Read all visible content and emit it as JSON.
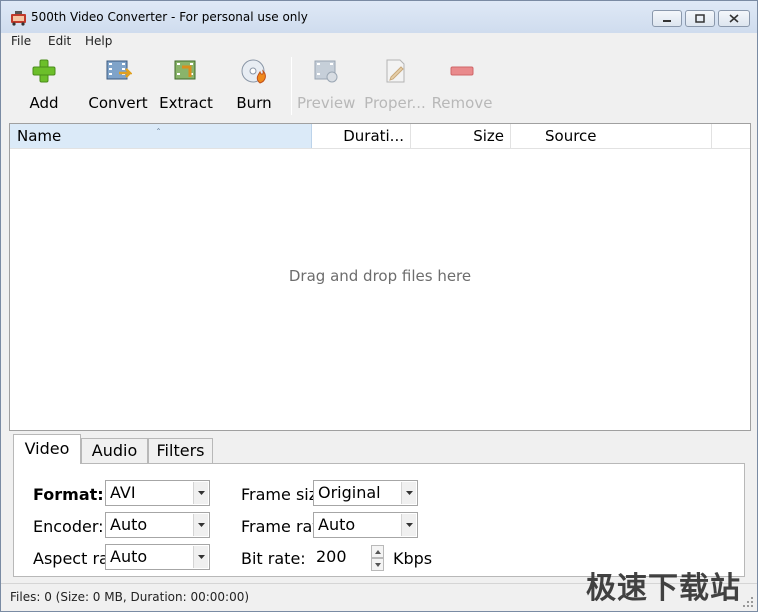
{
  "window": {
    "title": "500th Video Converter - For personal use only"
  },
  "menu": {
    "items": [
      "File",
      "Edit",
      "Help"
    ]
  },
  "toolbar": {
    "buttons": [
      {
        "label": "Add",
        "icon": "plus-icon",
        "enabled": true
      },
      {
        "label": "Convert",
        "icon": "convert-film-icon",
        "enabled": true
      },
      {
        "label": "Extract",
        "icon": "extract-icon",
        "enabled": true
      },
      {
        "label": "Burn",
        "icon": "burn-disc-icon",
        "enabled": true
      },
      {
        "label": "Preview",
        "icon": "preview-film-icon",
        "enabled": false
      },
      {
        "label": "Proper...",
        "icon": "properties-icon",
        "enabled": false
      },
      {
        "label": "Remove",
        "icon": "minus-icon",
        "enabled": false
      }
    ]
  },
  "file_list": {
    "columns": [
      "Name",
      "Durati...",
      "Size",
      "Source"
    ],
    "empty_hint": "Drag and drop files here"
  },
  "settings": {
    "tabs": [
      "Video",
      "Audio",
      "Filters"
    ],
    "active_tab": "Video",
    "video": {
      "format_label": "Format:",
      "format_value": "AVI",
      "encoder_label": "Encoder:",
      "encoder_value": "Auto",
      "aspect_label": "Aspect ra",
      "aspect_value": "Auto",
      "frame_size_label": "Frame siz",
      "frame_size_value": "Original",
      "frame_rate_label": "Frame rat",
      "frame_rate_value": "Auto",
      "bitrate_label": "Bit rate:",
      "bitrate_value": "200",
      "bitrate_unit": "Kbps"
    }
  },
  "status": {
    "text": "Files: 0 (Size: 0 MB, Duration: 00:00:00)"
  },
  "watermark": "极速下载站",
  "colors": {
    "header_highlight": "#dbeaf8",
    "disabled_text": "#b8b8b8",
    "add_green": "#6cbf2a",
    "remove_red": "#e3686b"
  }
}
